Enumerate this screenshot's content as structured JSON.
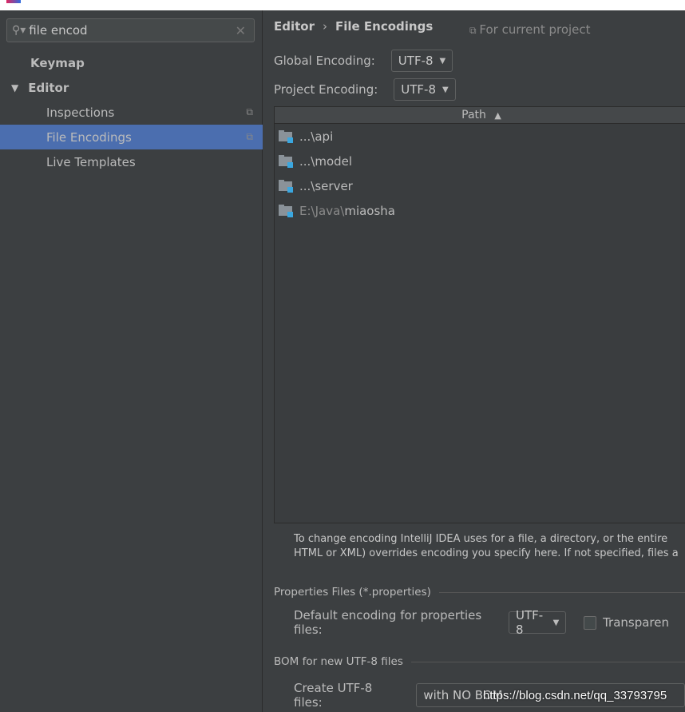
{
  "sidebar": {
    "search": {
      "value": "file encod"
    },
    "items": [
      {
        "label": "Keymap"
      },
      {
        "label": "Editor"
      },
      {
        "label": "Inspections"
      },
      {
        "label": "File Encodings"
      },
      {
        "label": "Live Templates"
      }
    ]
  },
  "main": {
    "breadcrumb": {
      "parent": "Editor",
      "separator": "›",
      "current": "File Encodings"
    },
    "for_current_project": "For current project",
    "global_encoding": {
      "label": "Global Encoding:",
      "value": "UTF-8"
    },
    "project_encoding": {
      "label": "Project Encoding:",
      "value": "UTF-8"
    },
    "table": {
      "header": "Path",
      "rows": [
        {
          "prefix": "...\\",
          "name": "api"
        },
        {
          "prefix": "...\\",
          "name": "model"
        },
        {
          "prefix": "...\\",
          "name": "server"
        },
        {
          "prefix": "E:\\Java\\",
          "name": "miaosha"
        }
      ]
    },
    "note_line1": "To change encoding IntelliJ IDEA uses for a file, a directory, or the entire",
    "note_line2": "HTML or XML) overrides encoding you specify here. If not specified, files a",
    "properties": {
      "title": "Properties Files (*.properties)",
      "label": "Default encoding for properties files:",
      "value": "UTF-8",
      "checkbox_label": "Transparen"
    },
    "bom": {
      "title": "BOM for new UTF-8 files",
      "label": "Create UTF-8 files:",
      "value": "with NO BOM"
    }
  },
  "watermark": "https://blog.csdn.net/qq_33793795",
  "colors": {
    "selection": "#4b6eaf",
    "background": "#3c3f41",
    "folder_badge": "#3aa7e0"
  }
}
